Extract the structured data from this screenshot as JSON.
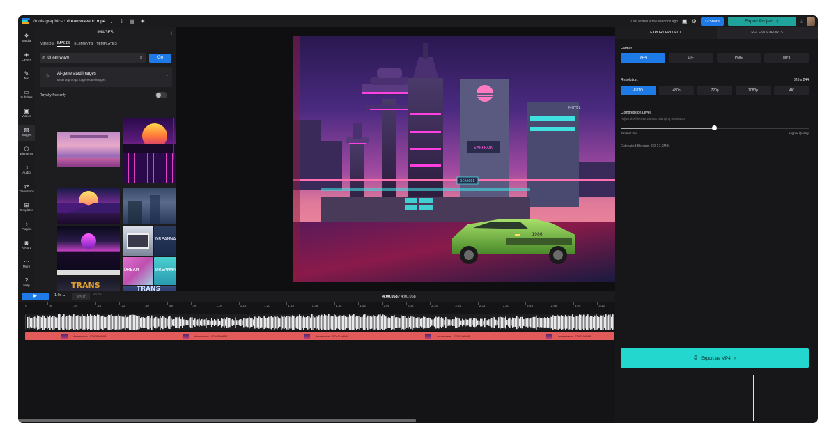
{
  "topbar": {
    "breadcrumb_root": "/tools graphics",
    "breadcrumb_sep": "›",
    "file_name": "dreamwave to mp4",
    "last_edited": "Last edited a few seconds ago",
    "share_label": "Share",
    "export_label": "Export Project"
  },
  "rail": {
    "items": [
      {
        "label": "Media",
        "icon": "media-icon",
        "glyph": "❖"
      },
      {
        "label": "Layers",
        "icon": "layers-icon",
        "glyph": "◈"
      },
      {
        "label": "Text",
        "icon": "text-icon",
        "glyph": "✎"
      },
      {
        "label": "Subtitles",
        "icon": "subtitles-icon",
        "glyph": "▭"
      },
      {
        "label": "Videos",
        "icon": "videos-icon",
        "glyph": "▣"
      },
      {
        "label": "Images",
        "icon": "images-icon",
        "glyph": "▨"
      },
      {
        "label": "Elements",
        "icon": "elements-icon",
        "glyph": "⬡"
      },
      {
        "label": "Audio",
        "icon": "audio-icon",
        "glyph": "♫"
      },
      {
        "label": "Transitions",
        "icon": "transitions-icon",
        "glyph": "⇄"
      },
      {
        "label": "Templates",
        "icon": "templates-icon",
        "glyph": "⊞"
      },
      {
        "label": "Plugins",
        "icon": "plugins-icon",
        "glyph": "♁"
      },
      {
        "label": "Record",
        "icon": "record-icon",
        "glyph": "◙"
      },
      {
        "label": "More",
        "icon": "more-icon",
        "glyph": "···"
      },
      {
        "label": "Help",
        "icon": "help-icon",
        "glyph": "?"
      }
    ],
    "active": "Images"
  },
  "panel": {
    "title": "IMAGES",
    "tabs": [
      "VIDEOS",
      "IMAGES",
      "ELEMENTS",
      "TEMPLATES"
    ],
    "active_tab": "IMAGES",
    "search_value": "dreamwave",
    "go_label": "Go",
    "ai_title": "AI-generated images",
    "ai_subtitle": "Enter a prompt to generate images",
    "royalty_label": "Royalty-free only",
    "royalty_on": false
  },
  "canvas": {
    "sign_motel": "MOTEL",
    "sign_store": "SEAGODE",
    "sign_small": "SAFFRON",
    "car_plate": "1986"
  },
  "export": {
    "tabs": [
      "EXPORT PROJECT",
      "RECENT EXPORTS"
    ],
    "active_tab": "EXPORT PROJECT",
    "format_label": "Format",
    "formats": [
      "MP4",
      "GIF",
      "PNG",
      "MP3"
    ],
    "selected_format": "MP4",
    "resolution_label": "Resolution:",
    "resolution_value": "326 x 244",
    "resolutions": [
      "AUTO",
      "480p",
      "720p",
      "1080p",
      "4K"
    ],
    "selected_resolution": "AUTO",
    "compression_label": "Compression Level",
    "compression_sub": "Adjust the file size without changing resolution",
    "compression_level": 0.5,
    "smaller_label": "Smaller File",
    "higher_label": "Higher Quality",
    "file_size": "Estimated file size: 6.9-17.2MB",
    "export_button": "Export as MP4"
  },
  "timeline": {
    "speed": "1.0x",
    "split_label": "SPLIT",
    "current_time": "4:00.068",
    "total_time": "/ 4:00.068",
    "ruler": [
      "0",
      ":8",
      ":16",
      ":24",
      ":32",
      ":40",
      ":48",
      ":56",
      "1:04",
      "1:12",
      "1:20",
      "1:28",
      "1:36",
      "1:44",
      "1:52",
      "2:00",
      "2:08",
      "2:16",
      "2:24",
      "2:32",
      "2:40",
      "2:48",
      "2:56",
      "3:04",
      "3:12"
    ],
    "clips": [
      "dreamwave  -  F7lc3Ua9W8",
      "dreamwave  -  F7lc3Ua9W8",
      "dreamwave  -  F7lc3Ua9W8",
      "dreamwave  -  F7lc3Ua9W8",
      "dreamwave  -  F7lc3Ua9W8"
    ]
  },
  "colors": {
    "accent": "#1e7ae6",
    "export_teal": "#23d6ce",
    "clip_red": "#e25a5a"
  }
}
